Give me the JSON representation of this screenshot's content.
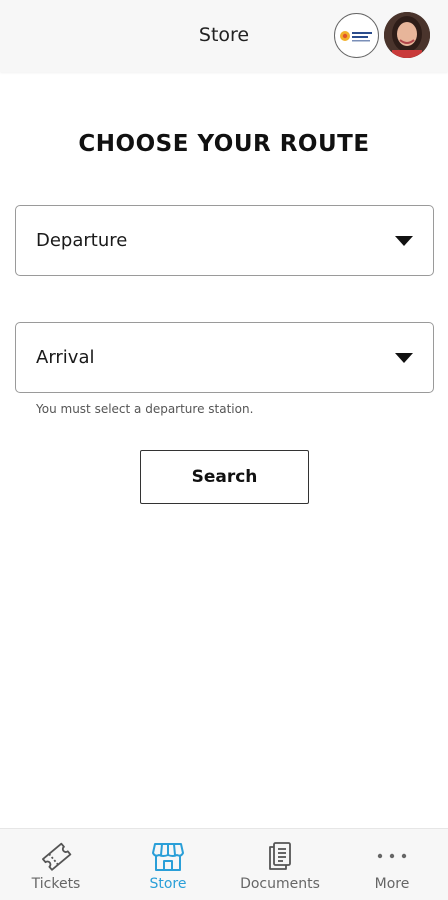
{
  "header": {
    "title": "Store"
  },
  "main": {
    "title": "CHOOSE YOUR ROUTE",
    "departure": {
      "value": "Departure"
    },
    "arrival": {
      "value": "Arrival"
    },
    "hint": "You must select a departure station.",
    "search_label": "Search"
  },
  "nav": {
    "items": [
      {
        "label": "Tickets",
        "icon": "ticket-icon"
      },
      {
        "label": "Store",
        "icon": "store-icon",
        "active": true
      },
      {
        "label": "Documents",
        "icon": "documents-icon"
      },
      {
        "label": "More",
        "icon": "more-icon"
      }
    ]
  },
  "colors": {
    "accent": "#2a9fd8",
    "header_bg": "#f7f7f7",
    "border": "#9a9a9a"
  }
}
